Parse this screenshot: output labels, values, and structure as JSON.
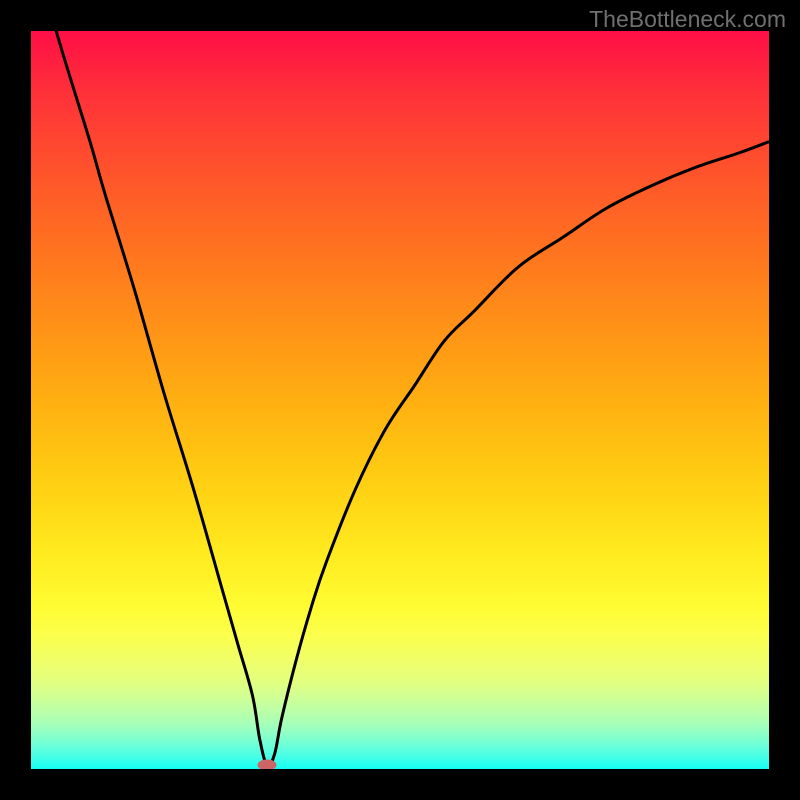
{
  "watermark": "TheBottleneck.com",
  "colors": {
    "frame": "#000000",
    "curve": "#000000",
    "marker": "#cc6666"
  },
  "chart_data": {
    "type": "line",
    "title": "",
    "xlabel": "",
    "ylabel": "",
    "xlim": [
      0,
      100
    ],
    "ylim": [
      0,
      100
    ],
    "grid": false,
    "legend": false,
    "x": [
      0,
      4,
      8,
      10,
      14,
      18,
      22,
      26,
      28,
      30,
      31,
      32,
      33,
      34,
      36,
      38,
      40,
      44,
      48,
      52,
      56,
      60,
      66,
      72,
      78,
      84,
      90,
      96,
      100
    ],
    "values": [
      112,
      98,
      85,
      78,
      65,
      51,
      38,
      24,
      17,
      10,
      4,
      0.5,
      2,
      7,
      15,
      22,
      28,
      38,
      46,
      52,
      58,
      62,
      68,
      72,
      76,
      79,
      81.5,
      83.5,
      85
    ],
    "series_note": "Single black curve; V-shaped dip near x≈32, asymptotic rise to ~85 on the right. Background is a vertical red→yellow→green gradient (bottleneck heatmap).",
    "marker": {
      "x": 32,
      "y": 0.5
    },
    "gradient_stops": [
      {
        "pos": 0,
        "color": "#ff0e46"
      },
      {
        "pos": 0.5,
        "color": "#ffaf12"
      },
      {
        "pos": 0.78,
        "color": "#fffc32"
      },
      {
        "pos": 1.0,
        "color": "#14fff4"
      }
    ]
  }
}
